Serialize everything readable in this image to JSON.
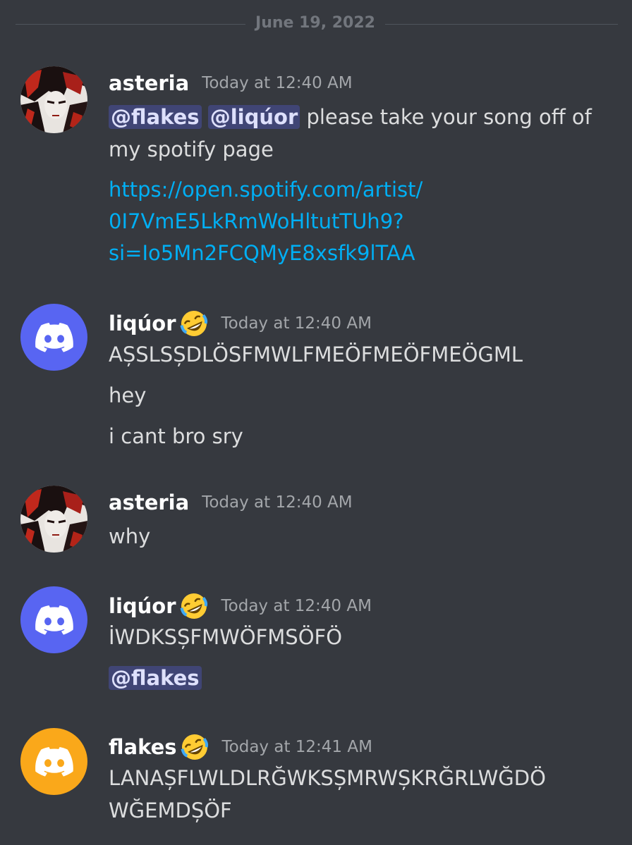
{
  "date_divider": "June 19, 2022",
  "colors": {
    "background": "#36393f",
    "link": "#00aff4",
    "mention_bg": "#414675",
    "avatar_blurple": "#5865f2",
    "avatar_orange": "#faa81a"
  },
  "messages": [
    {
      "author": "asteria",
      "timestamp": "Today at 12:40 AM",
      "avatar": "anime-art-avatar",
      "line1": {
        "mention1": "@flakes",
        "mention2": "@liqúor",
        "text": "please take your song off of"
      },
      "line2": "my spotify page",
      "link_lines": [
        "https://open.spotify.com/artist/",
        "0I7VmE5LkRmWoHltutTUh9?",
        "si=Io5Mn2FCQMyE8xsfk9lTAA"
      ]
    },
    {
      "author": "liqúor",
      "badge_icon": "rolling-on-floor-laughing-emoji",
      "timestamp": "Today at 12:40 AM",
      "avatar": "discord-default-avatar",
      "lines": [
        "AȘSLSȘDLÖSFMWLFMEÖFMEÖFMEÖGML",
        "hey",
        "i cant bro sry"
      ]
    },
    {
      "author": "asteria",
      "timestamp": "Today at 12:40 AM",
      "avatar": "anime-art-avatar",
      "lines": [
        "why"
      ]
    },
    {
      "author": "liqúor",
      "badge_icon": "rolling-on-floor-laughing-emoji",
      "timestamp": "Today at 12:40 AM",
      "avatar": "discord-default-avatar",
      "lines": [
        "İWDKSȘFMWÖFMSÖFÖ"
      ],
      "mention_line": "@flakes"
    },
    {
      "author": "flakes",
      "badge_icon": "rolling-on-floor-laughing-emoji",
      "timestamp": "Today at 12:41 AM",
      "avatar": "discord-default-avatar",
      "lines": [
        "LANAȘFLWLDLRĞWKSȘMRWȘKRĞRLWĞDÖ",
        "WĞEMDȘÖF"
      ]
    }
  ]
}
